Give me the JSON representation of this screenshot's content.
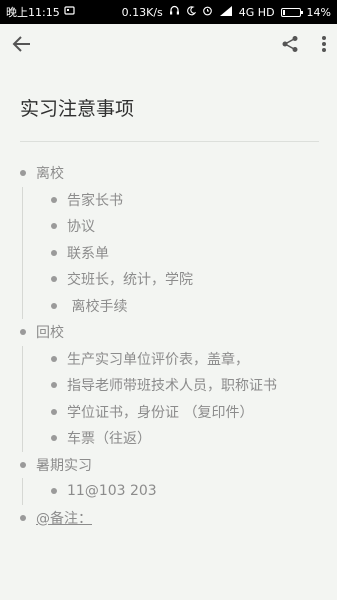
{
  "status_bar": {
    "time": "晚上11:15",
    "net_speed": "0.13K/s",
    "network": "4G HD",
    "battery": "14%",
    "battery_level": 0.14
  },
  "toolbar": {
    "back_icon": "arrow-back-icon",
    "share_icon": "share-icon",
    "more_icon": "more-vert-icon"
  },
  "note": {
    "title": "实习注意事项",
    "items": [
      {
        "label": "离校",
        "children": [
          "告家长书",
          "协议",
          "联系单",
          "交班长，统计，学院",
          " 离校手续"
        ]
      },
      {
        "label": "回校",
        "children": [
          "生产实习单位评价表，盖章，",
          "指导老师带班技术人员，职称证书",
          "学位证书，身份证 （复印件）",
          "车票（往返）"
        ]
      },
      {
        "label": "暑期实习",
        "children": [
          "11@103 203"
        ]
      },
      {
        "label": "@备注：",
        "children": []
      }
    ]
  }
}
